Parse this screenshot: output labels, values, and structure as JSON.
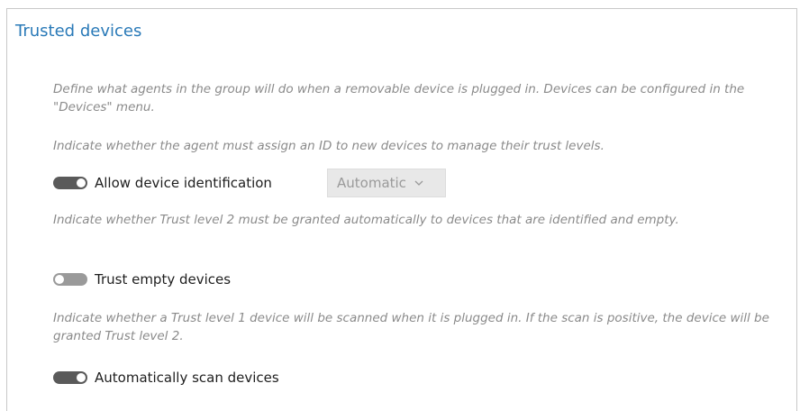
{
  "section": {
    "title": "Trusted devices",
    "intro": "Define what agents in the group will do when a removable device is plugged in. Devices can be configured in the \"Devices\" menu."
  },
  "device_identification": {
    "description": "Indicate whether the agent must assign an ID to new devices to manage their trust levels.",
    "label": "Allow device identification",
    "enabled": true,
    "mode_value": "Automatic",
    "mode_icon": "chevron-down-icon"
  },
  "trust_empty": {
    "description": "Indicate whether Trust level 2 must be granted automatically to devices that are identified and empty.",
    "label": "Trust empty devices",
    "enabled": false
  },
  "auto_scan": {
    "description": "Indicate whether a Trust level 1 device will be scanned when it is plugged in. If the scan is positive, the device will be granted Trust level 2.",
    "label": "Automatically scan devices",
    "enabled": true
  },
  "colors": {
    "title": "#2a7ab8",
    "toggle_on": "#5a5a5a",
    "toggle_off": "#9a9a9a"
  }
}
